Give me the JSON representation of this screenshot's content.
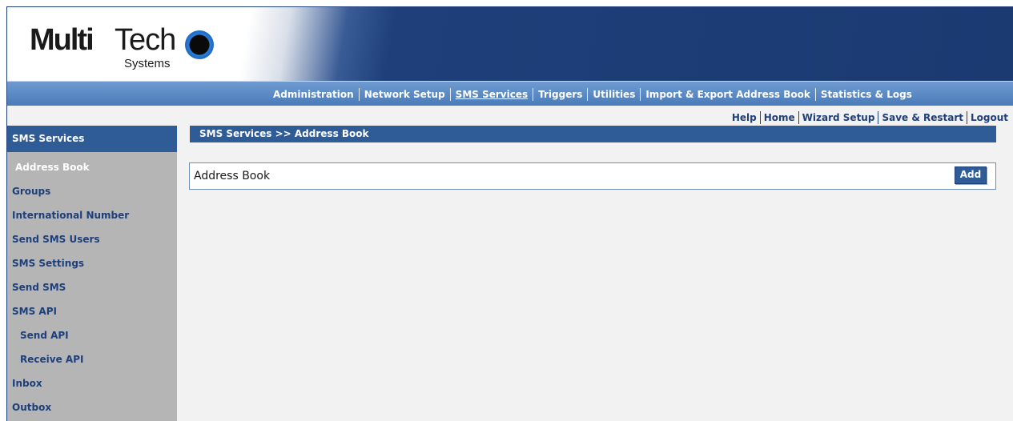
{
  "logo": {
    "brand_bold": "Multi",
    "brand_light": "Tech",
    "subtitle": "Systems"
  },
  "topnav": {
    "items": [
      "Administration",
      "Network Setup",
      "SMS Services",
      "Triggers",
      "Utilities",
      "Import & Export Address Book",
      "Statistics & Logs"
    ],
    "active": "SMS Services"
  },
  "utility": {
    "items": [
      "Help",
      "Home",
      "Wizard Setup",
      "Save & Restart",
      "Logout"
    ]
  },
  "sidebar": {
    "title": "SMS Services",
    "items": [
      {
        "label": "Address Book",
        "active": true
      },
      {
        "label": "Groups"
      },
      {
        "label": "International Number"
      },
      {
        "label": "Send SMS Users"
      },
      {
        "label": "SMS Settings"
      },
      {
        "label": "Send SMS"
      },
      {
        "label": "SMS API"
      },
      {
        "label": "Send API",
        "sub": true
      },
      {
        "label": "Receive API",
        "sub": true
      },
      {
        "label": "Inbox"
      },
      {
        "label": "Outbox"
      }
    ]
  },
  "main": {
    "breadcrumb": "SMS Services >> Address Book",
    "panel_title": "Address Book",
    "add_label": "Add"
  },
  "colors": {
    "brand_blue": "#1e3f7a",
    "bar_blue": "#2f5c97",
    "sidebar_gray": "#b5b5b5",
    "logo_ring": "#2c7fd9"
  }
}
